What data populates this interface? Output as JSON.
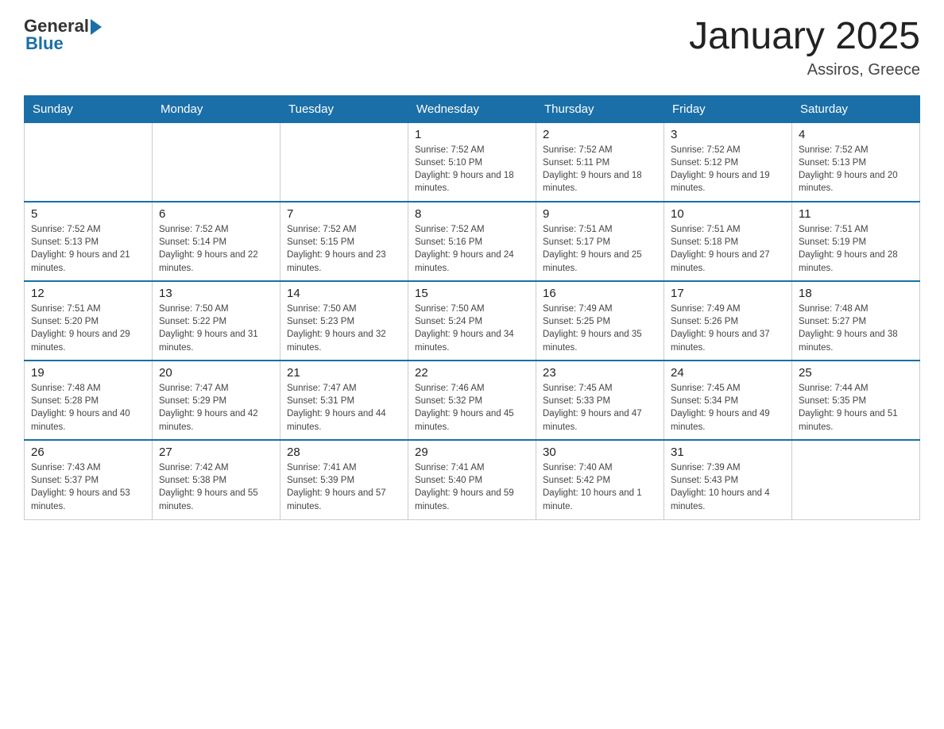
{
  "header": {
    "logo_general": "General",
    "logo_blue": "Blue",
    "month_title": "January 2025",
    "location": "Assiros, Greece"
  },
  "days_of_week": [
    "Sunday",
    "Monday",
    "Tuesday",
    "Wednesday",
    "Thursday",
    "Friday",
    "Saturday"
  ],
  "weeks": [
    [
      {
        "day": "",
        "sunrise": "",
        "sunset": "",
        "daylight": ""
      },
      {
        "day": "",
        "sunrise": "",
        "sunset": "",
        "daylight": ""
      },
      {
        "day": "",
        "sunrise": "",
        "sunset": "",
        "daylight": ""
      },
      {
        "day": "1",
        "sunrise": "Sunrise: 7:52 AM",
        "sunset": "Sunset: 5:10 PM",
        "daylight": "Daylight: 9 hours and 18 minutes."
      },
      {
        "day": "2",
        "sunrise": "Sunrise: 7:52 AM",
        "sunset": "Sunset: 5:11 PM",
        "daylight": "Daylight: 9 hours and 18 minutes."
      },
      {
        "day": "3",
        "sunrise": "Sunrise: 7:52 AM",
        "sunset": "Sunset: 5:12 PM",
        "daylight": "Daylight: 9 hours and 19 minutes."
      },
      {
        "day": "4",
        "sunrise": "Sunrise: 7:52 AM",
        "sunset": "Sunset: 5:13 PM",
        "daylight": "Daylight: 9 hours and 20 minutes."
      }
    ],
    [
      {
        "day": "5",
        "sunrise": "Sunrise: 7:52 AM",
        "sunset": "Sunset: 5:13 PM",
        "daylight": "Daylight: 9 hours and 21 minutes."
      },
      {
        "day": "6",
        "sunrise": "Sunrise: 7:52 AM",
        "sunset": "Sunset: 5:14 PM",
        "daylight": "Daylight: 9 hours and 22 minutes."
      },
      {
        "day": "7",
        "sunrise": "Sunrise: 7:52 AM",
        "sunset": "Sunset: 5:15 PM",
        "daylight": "Daylight: 9 hours and 23 minutes."
      },
      {
        "day": "8",
        "sunrise": "Sunrise: 7:52 AM",
        "sunset": "Sunset: 5:16 PM",
        "daylight": "Daylight: 9 hours and 24 minutes."
      },
      {
        "day": "9",
        "sunrise": "Sunrise: 7:51 AM",
        "sunset": "Sunset: 5:17 PM",
        "daylight": "Daylight: 9 hours and 25 minutes."
      },
      {
        "day": "10",
        "sunrise": "Sunrise: 7:51 AM",
        "sunset": "Sunset: 5:18 PM",
        "daylight": "Daylight: 9 hours and 27 minutes."
      },
      {
        "day": "11",
        "sunrise": "Sunrise: 7:51 AM",
        "sunset": "Sunset: 5:19 PM",
        "daylight": "Daylight: 9 hours and 28 minutes."
      }
    ],
    [
      {
        "day": "12",
        "sunrise": "Sunrise: 7:51 AM",
        "sunset": "Sunset: 5:20 PM",
        "daylight": "Daylight: 9 hours and 29 minutes."
      },
      {
        "day": "13",
        "sunrise": "Sunrise: 7:50 AM",
        "sunset": "Sunset: 5:22 PM",
        "daylight": "Daylight: 9 hours and 31 minutes."
      },
      {
        "day": "14",
        "sunrise": "Sunrise: 7:50 AM",
        "sunset": "Sunset: 5:23 PM",
        "daylight": "Daylight: 9 hours and 32 minutes."
      },
      {
        "day": "15",
        "sunrise": "Sunrise: 7:50 AM",
        "sunset": "Sunset: 5:24 PM",
        "daylight": "Daylight: 9 hours and 34 minutes."
      },
      {
        "day": "16",
        "sunrise": "Sunrise: 7:49 AM",
        "sunset": "Sunset: 5:25 PM",
        "daylight": "Daylight: 9 hours and 35 minutes."
      },
      {
        "day": "17",
        "sunrise": "Sunrise: 7:49 AM",
        "sunset": "Sunset: 5:26 PM",
        "daylight": "Daylight: 9 hours and 37 minutes."
      },
      {
        "day": "18",
        "sunrise": "Sunrise: 7:48 AM",
        "sunset": "Sunset: 5:27 PM",
        "daylight": "Daylight: 9 hours and 38 minutes."
      }
    ],
    [
      {
        "day": "19",
        "sunrise": "Sunrise: 7:48 AM",
        "sunset": "Sunset: 5:28 PM",
        "daylight": "Daylight: 9 hours and 40 minutes."
      },
      {
        "day": "20",
        "sunrise": "Sunrise: 7:47 AM",
        "sunset": "Sunset: 5:29 PM",
        "daylight": "Daylight: 9 hours and 42 minutes."
      },
      {
        "day": "21",
        "sunrise": "Sunrise: 7:47 AM",
        "sunset": "Sunset: 5:31 PM",
        "daylight": "Daylight: 9 hours and 44 minutes."
      },
      {
        "day": "22",
        "sunrise": "Sunrise: 7:46 AM",
        "sunset": "Sunset: 5:32 PM",
        "daylight": "Daylight: 9 hours and 45 minutes."
      },
      {
        "day": "23",
        "sunrise": "Sunrise: 7:45 AM",
        "sunset": "Sunset: 5:33 PM",
        "daylight": "Daylight: 9 hours and 47 minutes."
      },
      {
        "day": "24",
        "sunrise": "Sunrise: 7:45 AM",
        "sunset": "Sunset: 5:34 PM",
        "daylight": "Daylight: 9 hours and 49 minutes."
      },
      {
        "day": "25",
        "sunrise": "Sunrise: 7:44 AM",
        "sunset": "Sunset: 5:35 PM",
        "daylight": "Daylight: 9 hours and 51 minutes."
      }
    ],
    [
      {
        "day": "26",
        "sunrise": "Sunrise: 7:43 AM",
        "sunset": "Sunset: 5:37 PM",
        "daylight": "Daylight: 9 hours and 53 minutes."
      },
      {
        "day": "27",
        "sunrise": "Sunrise: 7:42 AM",
        "sunset": "Sunset: 5:38 PM",
        "daylight": "Daylight: 9 hours and 55 minutes."
      },
      {
        "day": "28",
        "sunrise": "Sunrise: 7:41 AM",
        "sunset": "Sunset: 5:39 PM",
        "daylight": "Daylight: 9 hours and 57 minutes."
      },
      {
        "day": "29",
        "sunrise": "Sunrise: 7:41 AM",
        "sunset": "Sunset: 5:40 PM",
        "daylight": "Daylight: 9 hours and 59 minutes."
      },
      {
        "day": "30",
        "sunrise": "Sunrise: 7:40 AM",
        "sunset": "Sunset: 5:42 PM",
        "daylight": "Daylight: 10 hours and 1 minute."
      },
      {
        "day": "31",
        "sunrise": "Sunrise: 7:39 AM",
        "sunset": "Sunset: 5:43 PM",
        "daylight": "Daylight: 10 hours and 4 minutes."
      },
      {
        "day": "",
        "sunrise": "",
        "sunset": "",
        "daylight": ""
      }
    ]
  ]
}
